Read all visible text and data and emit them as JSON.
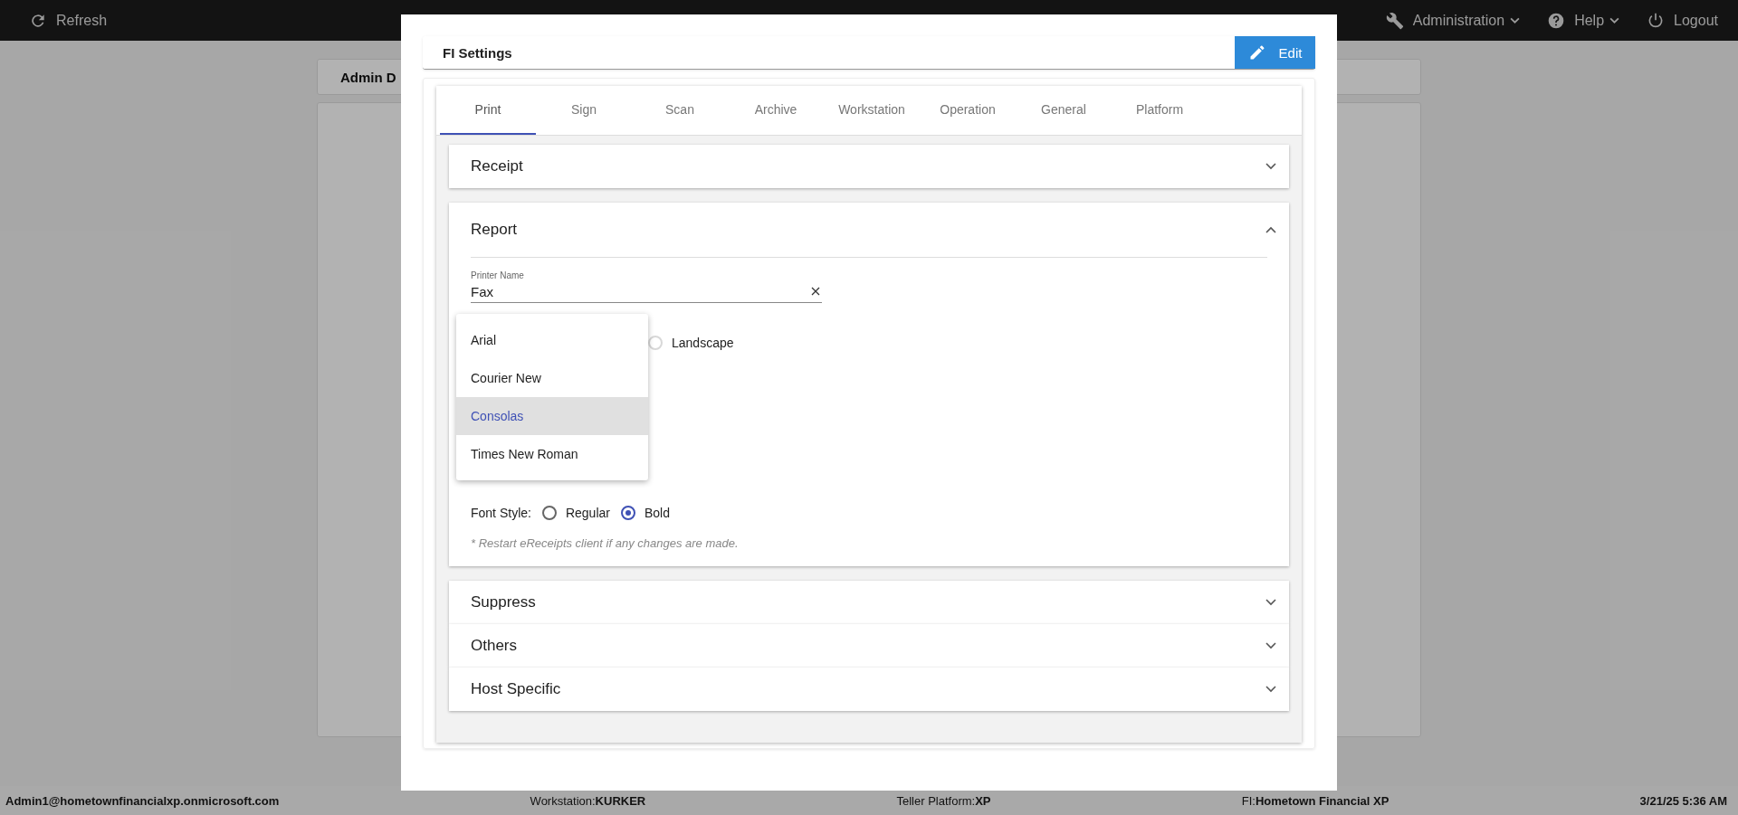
{
  "top_bar": {
    "left": [
      {
        "kind": "refresh",
        "label": "Refresh"
      }
    ],
    "right": [
      {
        "kind": "admin",
        "label": "Administration",
        "menu": true
      },
      {
        "kind": "help",
        "label": "Help",
        "menu": true
      },
      {
        "kind": "logout",
        "label": "Logout",
        "menu": false
      }
    ]
  },
  "page": {
    "card_title": "Admin D"
  },
  "modal": {
    "title": "FI Settings",
    "edit_button": "Edit",
    "tabs": [
      {
        "label": "Print",
        "selected": true
      },
      {
        "label": "Sign",
        "selected": false
      },
      {
        "label": "Scan",
        "selected": false
      },
      {
        "label": "Archive",
        "selected": false
      },
      {
        "label": "Workstation",
        "selected": false
      },
      {
        "label": "Operation",
        "selected": false
      },
      {
        "label": "General",
        "selected": false
      },
      {
        "label": "Platform",
        "selected": false
      }
    ],
    "sections": [
      {
        "title": "Receipt",
        "expanded": false
      },
      {
        "title": "Report",
        "expanded": true
      },
      {
        "title": "Suppress",
        "expanded": false
      },
      {
        "title": "Others",
        "expanded": false
      },
      {
        "title": "Host Specific",
        "expanded": false
      }
    ],
    "report": {
      "printer_name": {
        "label": "Printer Name",
        "value": "Fax"
      },
      "orientation": {
        "options": [
          {
            "label": "Landscape",
            "selected": false
          }
        ]
      },
      "font_style": {
        "label": "Font Style:",
        "options": [
          {
            "label": "Regular",
            "selected": false
          },
          {
            "label": "Bold",
            "selected": true
          }
        ]
      },
      "note": "* Restart eReceipts client if any changes are made."
    },
    "dropdown": {
      "options": [
        {
          "label": "Arial",
          "selected": false
        },
        {
          "label": "Courier New",
          "selected": false
        },
        {
          "label": "Consolas",
          "selected": true
        },
        {
          "label": "Times New Roman",
          "selected": false
        }
      ]
    }
  },
  "status_bar": [
    {
      "value": "Admin1@hometownfinancialxp.onmicrosoft.com"
    },
    {
      "label": "Workstation:",
      "value": "KURKER"
    },
    {
      "label": "Teller Platform:",
      "value": "XP"
    },
    {
      "label": "FI:",
      "value": "Hometown Financial XP"
    },
    {
      "value": "3/21/25 5:36 AM"
    }
  ]
}
